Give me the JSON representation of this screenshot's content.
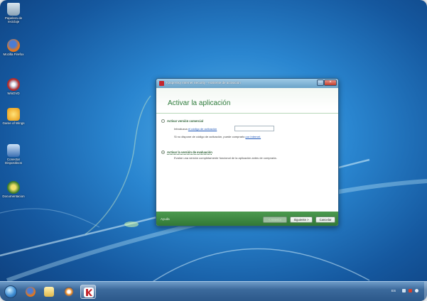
{
  "desktop": {
    "icons": [
      {
        "name": "recycle-bin",
        "label": "Papelera de reciclaje",
        "color": "#9fb7c9"
      },
      {
        "name": "firefox",
        "label": "Mozilla Firefox",
        "color": "#e4761b"
      },
      {
        "name": "dvd",
        "label": "WinDVD",
        "color": "#b02a2a"
      },
      {
        "name": "game",
        "label": "Game of Wings",
        "color": "#f0b81a"
      },
      {
        "name": "network",
        "label": "Conectar Dispositivos",
        "color": "#3b6fb3"
      },
      {
        "name": "installer",
        "label": "Documentacion",
        "color": "#3a7a2a"
      }
    ]
  },
  "window": {
    "title": "Kaspersky Internet Security - Asistente de activación",
    "heading": "Activar la aplicación",
    "option_commercial": {
      "label": "Activar versión comercial",
      "code_prefix": "Introduzca",
      "code_link": "el código de activación",
      "code_value": "",
      "no_code_text": "Si no dispone de código de activación, puede comprarlo",
      "buy_link": "por Internet."
    },
    "option_trial": {
      "label": "Activar la versión de evaluación",
      "description": "Evalúe una versión completamente funcional de la aplicación antes de comprarla."
    },
    "selected_option": "trial",
    "footer": {
      "help": "Ayuda",
      "back": "< Anterior",
      "next": "Siguiente >",
      "cancel": "Cancelar"
    },
    "colors": {
      "accent": "#2d7a3a",
      "footer": "#3a8540"
    }
  },
  "taskbar": {
    "items": [
      "windows-explorer-ie",
      "firefox",
      "folder",
      "media-player",
      "kaspersky"
    ],
    "tray_lang": "ES"
  }
}
